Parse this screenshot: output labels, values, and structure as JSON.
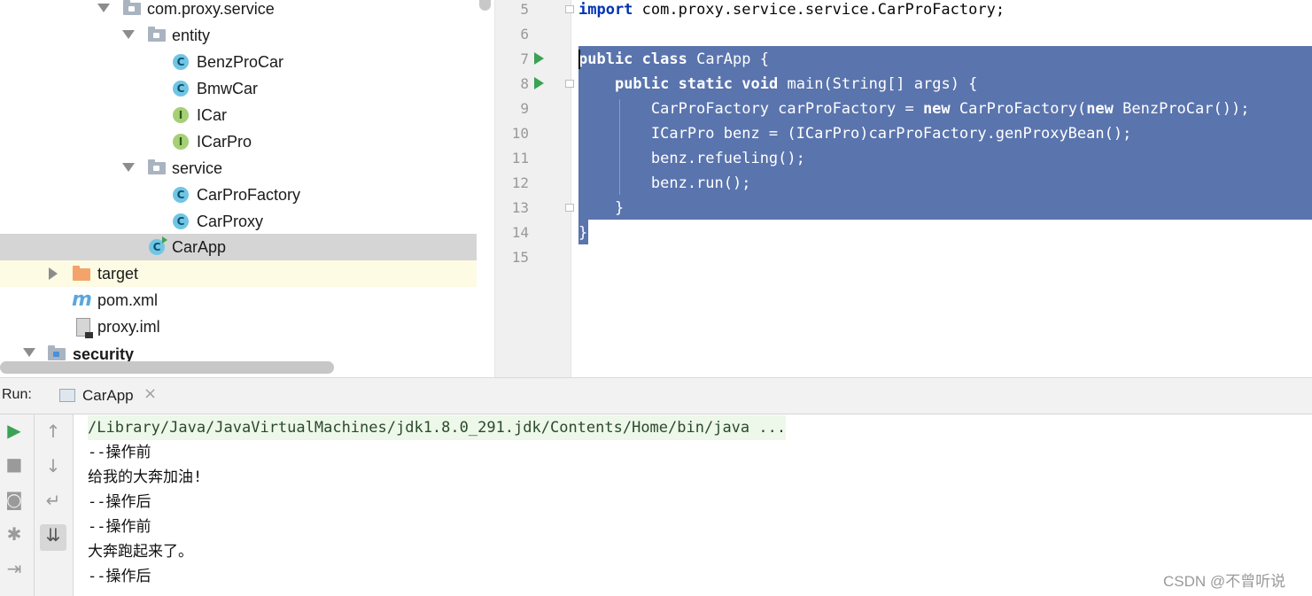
{
  "tree": {
    "items": [
      {
        "label": "com.proxy.service",
        "kind": "package"
      },
      {
        "label": "entity",
        "kind": "package"
      },
      {
        "label": "BenzProCar",
        "kind": "class",
        "badge": "C"
      },
      {
        "label": "BmwCar",
        "kind": "class",
        "badge": "C"
      },
      {
        "label": "ICar",
        "kind": "interface",
        "badge": "I"
      },
      {
        "label": "ICarPro",
        "kind": "interface",
        "badge": "I"
      },
      {
        "label": "service",
        "kind": "package"
      },
      {
        "label": "CarProFactory",
        "kind": "class",
        "badge": "C"
      },
      {
        "label": "CarProxy",
        "kind": "class",
        "badge": "C"
      },
      {
        "label": "CarApp",
        "kind": "runnable-class",
        "badge": "C",
        "selected": true
      },
      {
        "label": "target",
        "kind": "folder-excluded"
      },
      {
        "label": "pom.xml",
        "kind": "maven",
        "badge": "m"
      },
      {
        "label": "proxy.iml",
        "kind": "iml"
      },
      {
        "label": "security",
        "kind": "module"
      }
    ]
  },
  "editor": {
    "line_numbers": [
      "5",
      "6",
      "7",
      "8",
      "9",
      "10",
      "11",
      "12",
      "13",
      "14",
      "15"
    ],
    "lines": {
      "l5": {
        "kw": "import",
        "rest": " com.proxy.service.service.CarProFactory;"
      },
      "l7": {
        "kw1": "public",
        "sp1": " ",
        "kw2": "class",
        "rest": " CarApp {"
      },
      "l8": {
        "indent": "    ",
        "kw1": "public",
        "sp1": " ",
        "kw2": "static",
        "sp2": " ",
        "kw3": "void",
        "rest": " main(String[] args) {"
      },
      "l9": {
        "a": "        CarProFactory carProFactory = ",
        "kw1": "new",
        "b": " CarProFactory(",
        "kw2": "new",
        "c": " BenzProCar());"
      },
      "l10": "        ICarPro benz = (ICarPro)carProFactory.genProxyBean();",
      "l11": "        benz.refueling();",
      "l12": "        benz.run();",
      "l13": "    }",
      "l14": "}"
    }
  },
  "run": {
    "label": "Run:",
    "tab": "CarApp",
    "close": "×",
    "toolbar": {
      "rerun": "▶",
      "stop": "■",
      "snapshot": "◙",
      "debug": "✱",
      "exit": "⇥",
      "up": "↑",
      "down": "↓",
      "wrap": "↵",
      "scroll": "⇊"
    },
    "console": [
      "/Library/Java/JavaVirtualMachines/jdk1.8.0_291.jdk/Contents/Home/bin/java ...",
      "--操作前",
      "给我的大奔加油!",
      "--操作后",
      "--操作前",
      "大奔跑起来了。",
      "--操作后"
    ]
  },
  "watermark": "CSDN @不曾听说"
}
